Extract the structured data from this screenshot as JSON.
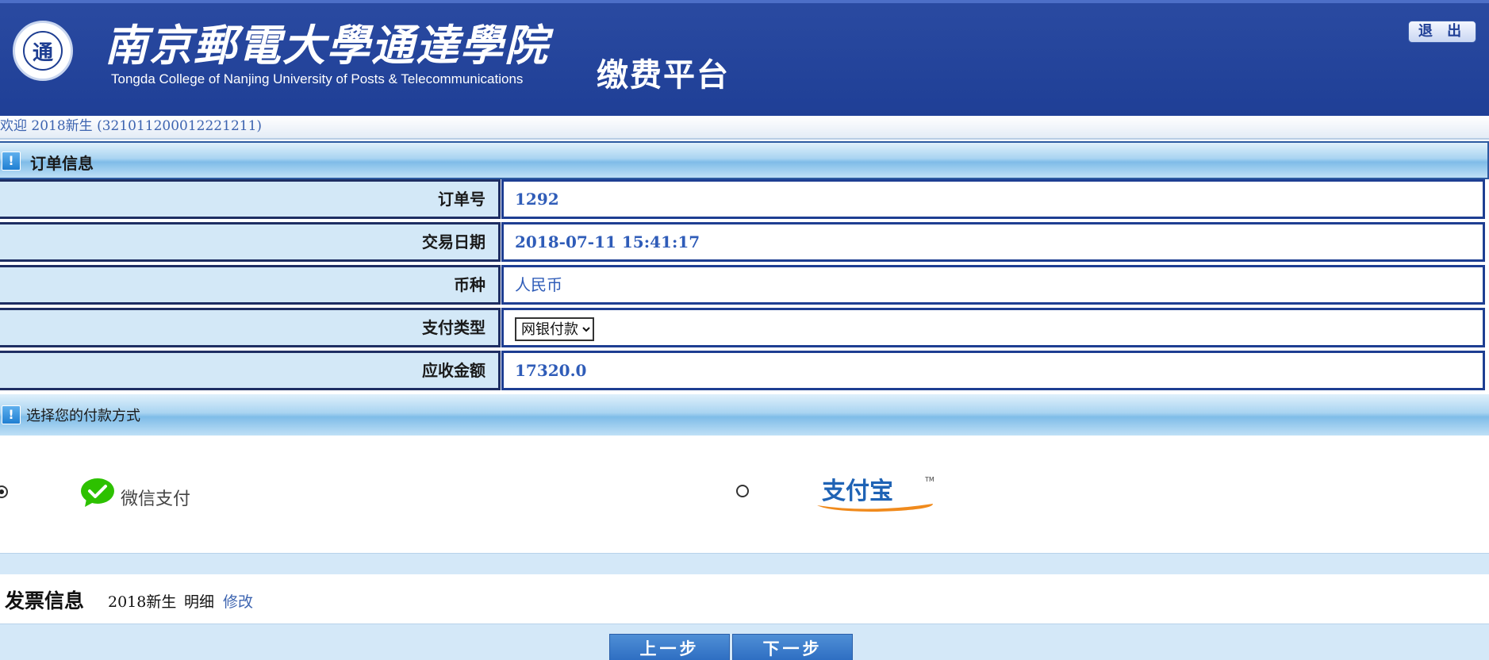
{
  "header": {
    "logo_char": "通",
    "school_name_cn": "南京郵電大學通達學院",
    "school_name_en": "Tongda College of Nanjing University of Posts & Telecommunications",
    "platform_title": "缴费平台",
    "logout_label": "退 出"
  },
  "welcome": {
    "text": "欢迎 2018新生 (321011200012221211)"
  },
  "order_section": {
    "title": "订单信息",
    "icon_text": "!",
    "rows": [
      {
        "label": "订单号",
        "value": "1292"
      },
      {
        "label": "交易日期",
        "value": "2018-07-11 15:41:17"
      },
      {
        "label": "币种",
        "value": "人民币"
      },
      {
        "label": "支付类型",
        "value": "网银付款"
      },
      {
        "label": "应收金额",
        "value": "17320.0"
      }
    ],
    "pay_type_options": [
      "网银付款"
    ]
  },
  "payment_section": {
    "title": "选择您的付款方式",
    "icon_text": "!",
    "wechat_label": "微信支付",
    "alipay_label": "支付宝",
    "alipay_tm": "TM",
    "selected": "wechat",
    "colors": {
      "wechat": "#2dc100",
      "alipay_blue": "#1f63b5",
      "alipay_orange": "#f08a1c"
    }
  },
  "invoice": {
    "title": "发票信息",
    "name": "2018新生",
    "detail_label": "明细",
    "edit_label": "修改"
  },
  "navigation": {
    "prev_label": "上一步",
    "next_label": "下一步"
  }
}
